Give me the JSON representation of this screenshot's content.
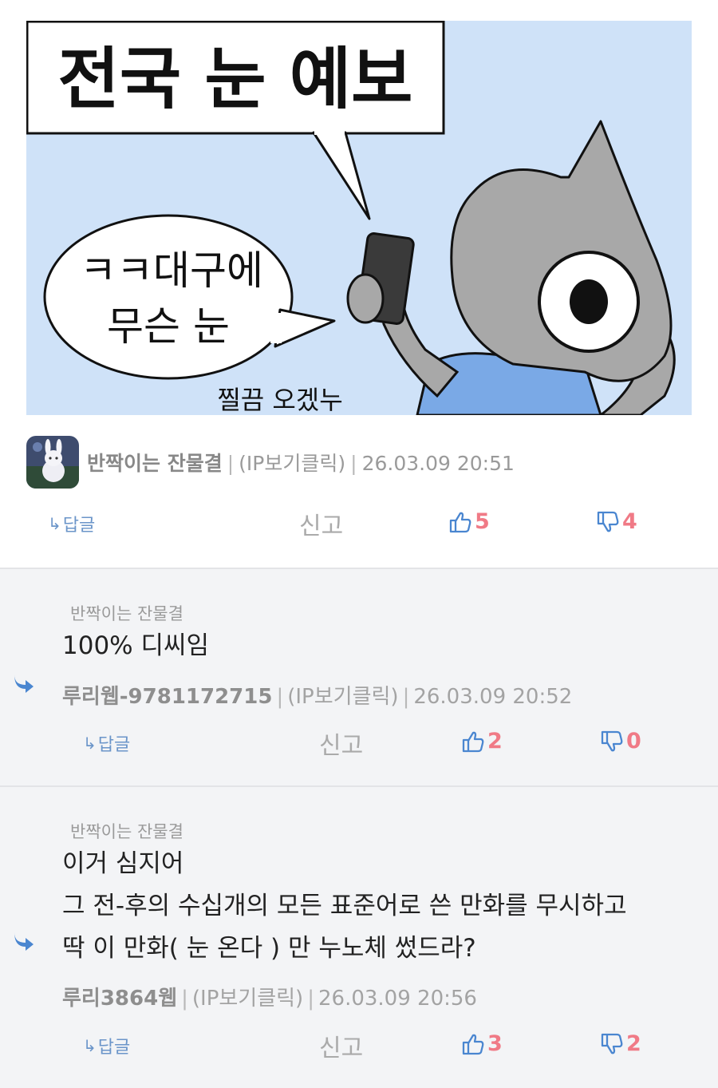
{
  "comic": {
    "caption_box": "전국 눈 예보",
    "speech_line1": "ㅋㅋ대구에",
    "speech_line2": "무슨 눈",
    "bottom_text": "찔끔 오겠누",
    "bg_color": "#cfe2f8"
  },
  "post": {
    "nickname": "반짝이는 잔물결",
    "ip_link": "(IP보기클릭)",
    "datetime": "26.03.09 20:51",
    "reply_label": "답글",
    "report_label": "신고",
    "likes": "5",
    "dislikes": "4"
  },
  "replies": [
    {
      "reply_to": "반짝이는 잔물결",
      "body": "100% 디씨임",
      "nickname": "루리웹-9781172715",
      "ip_link": "(IP보기클릭)",
      "datetime": "26.03.09 20:52",
      "reply_label": "답글",
      "report_label": "신고",
      "likes": "2",
      "dislikes": "0"
    },
    {
      "reply_to": "반짝이는 잔물결",
      "body": "이거 심지어\n그 전-후의 수십개의 모든 표준어로 쓴 만화를 무시하고\n딱 이 만화( 눈 온다 ) 만 누노체 썼드라?",
      "nickname": "루리3864웹",
      "ip_link": "(IP보기클릭)",
      "datetime": "26.03.09 20:56",
      "reply_label": "답글",
      "report_label": "신고",
      "likes": "3",
      "dislikes": "2"
    }
  ],
  "colors": {
    "accent_blue": "#4a86d0",
    "vote_count": "#f07a86",
    "reply_bg": "#f3f4f6"
  },
  "icons": {
    "reply": "reply-arrow-icon",
    "like": "thumbs-up-icon",
    "dislike": "thumbs-down-icon"
  }
}
